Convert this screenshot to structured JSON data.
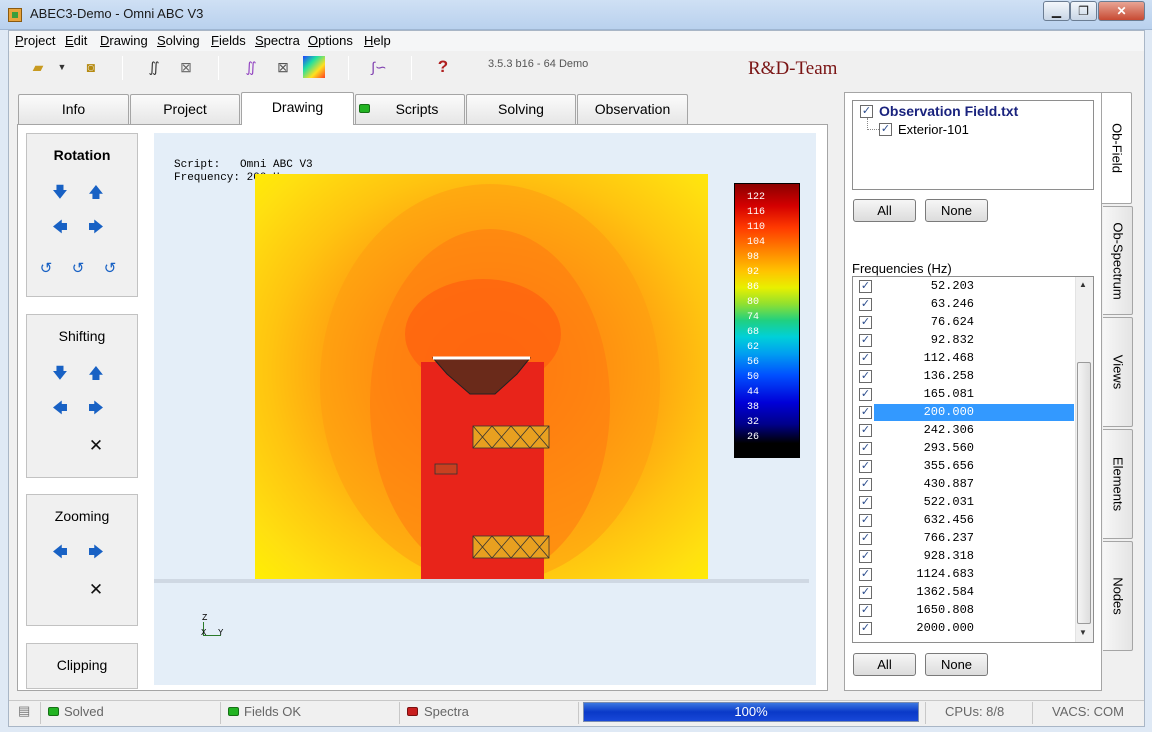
{
  "window": {
    "title": "ABEC3-Demo - Omni ABC V3",
    "min": "▁",
    "max": "❐",
    "close": "✕"
  },
  "menu": [
    "Project",
    "Edit",
    "Drawing",
    "Solving",
    "Fields",
    "Spectra",
    "Options",
    "Help"
  ],
  "toolbar": {
    "icons": [
      "open-folder-icon",
      "dropdown-icon",
      "save-icon",
      "integral-icon",
      "mesh-icon",
      "spectrum-icon",
      "wireframe-icon",
      "field-color-icon",
      "integral-plot-icon",
      "help-icon"
    ],
    "version": "3.5.3 b16 - 64 Demo",
    "team": "R&D-Team"
  },
  "tabs": [
    "Info",
    "Project",
    "Drawing",
    "Scripts",
    "Solving",
    "Observation"
  ],
  "active_tab": "Drawing",
  "controls": {
    "rotation": "Rotation",
    "shifting": "Shifting",
    "zooming": "Zooming",
    "clipping": "Clipping"
  },
  "drawing": {
    "script_label": "Script:",
    "script_value": "Omni ABC V3",
    "freq_label": "Frequency:",
    "freq_value": "200 Hz",
    "axis": {
      "z": "Z",
      "x": "X",
      "y": "Y"
    }
  },
  "colorbar": {
    "labels": [
      "122",
      "116",
      "110",
      "104",
      "98",
      "92",
      "86",
      "80",
      "74",
      "68",
      "62",
      "56",
      "50",
      "44",
      "38",
      "32",
      "26"
    ]
  },
  "right_panel": {
    "side_tabs": [
      "Ob-Field",
      "Ob-Spectrum",
      "Views",
      "Elements",
      "Nodes"
    ],
    "tree_root": "Observation Field.txt",
    "tree_child": "Exterior-101",
    "all_label": "All",
    "none_label": "None",
    "freq_title": "Frequencies  (Hz)",
    "frequencies": [
      "52.203",
      "63.246",
      "76.624",
      "92.832",
      "112.468",
      "136.258",
      "165.081",
      "200.000",
      "242.306",
      "293.560",
      "355.656",
      "430.887",
      "522.031",
      "632.456",
      "766.237",
      "928.318",
      "1124.683",
      "1362.584",
      "1650.808",
      "2000.000"
    ],
    "selected_frequency": "200.000"
  },
  "status": {
    "solved": "Solved",
    "fields_ok": "Fields OK",
    "spectra": "Spectra",
    "progress": "100%",
    "progress_value": 1.0,
    "cpus": "CPUs: 8/8",
    "vacs": "VACS: COM"
  }
}
